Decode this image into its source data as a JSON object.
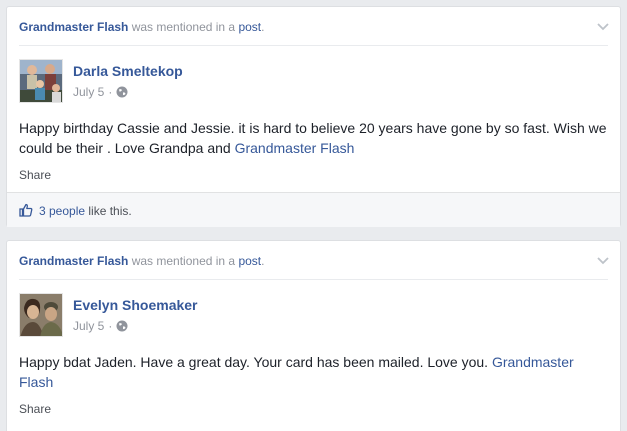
{
  "posts": [
    {
      "mention": {
        "page_name": "Grandmaster Flash",
        "middle": " was mentioned in a ",
        "post_word": "post",
        "end": "."
      },
      "author": "Darla Smeltekop",
      "date": "July 5",
      "separator": "·",
      "body": "Happy birthday Cassie and Jessie. it is hard to believe 20 years have gone by so fast. Wish we could be their . Love Grandpa and ",
      "tag": "Grandmaster Flash",
      "share_label": "Share",
      "likes": {
        "count_text": "3 people",
        "suffix": " like this."
      }
    },
    {
      "mention": {
        "page_name": "Grandmaster Flash",
        "middle": " was mentioned in a ",
        "post_word": "post",
        "end": "."
      },
      "author": "Evelyn Shoemaker",
      "date": "July 5",
      "separator": "·",
      "body": "Happy bdat Jaden. Have a great day. Your card has been mailed. Love you. ",
      "tag": "Grandmaster Flash",
      "share_label": "Share"
    }
  ],
  "icons": {
    "chevron": "chevron-down-icon",
    "audience": "globe-icon",
    "like": "thumbs-up-icon"
  },
  "colors": {
    "link": "#365899",
    "meta": "#90949c",
    "background": "#e9ebee"
  }
}
